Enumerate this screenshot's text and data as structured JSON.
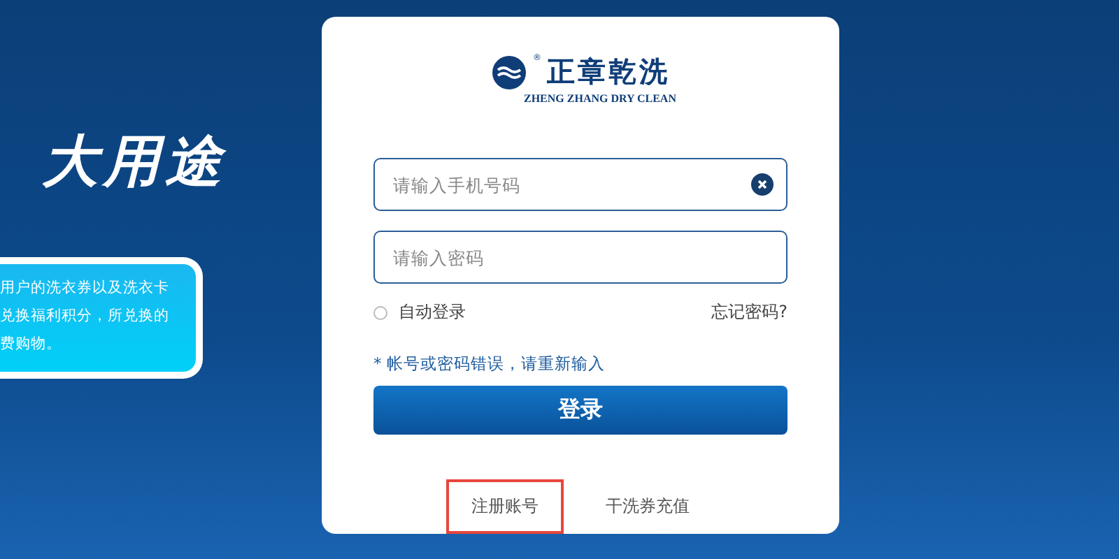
{
  "promo": {
    "heading": "大用途",
    "lines": [
      "用户的洗衣券以及洗衣卡",
      "兑换福利积分，所兑换的",
      "费购物。"
    ]
  },
  "login": {
    "logo": {
      "name": "正章乾洗",
      "mark": "®",
      "subtitle": "ZHENG ZHANG DRY CLEAN"
    },
    "phone_field": {
      "placeholder": "请输入手机号码"
    },
    "password_field": {
      "placeholder": "请输入密码"
    },
    "auto_login": {
      "label": "自动登录",
      "checked": false
    },
    "forgot_link": "忘记密码?",
    "error": "* 帐号或密码错误，请重新输入",
    "submit": "登录",
    "footer_links": [
      {
        "label": "注册账号",
        "highlighted": true
      },
      {
        "label": "干洗券充值",
        "highlighted": false
      }
    ]
  }
}
